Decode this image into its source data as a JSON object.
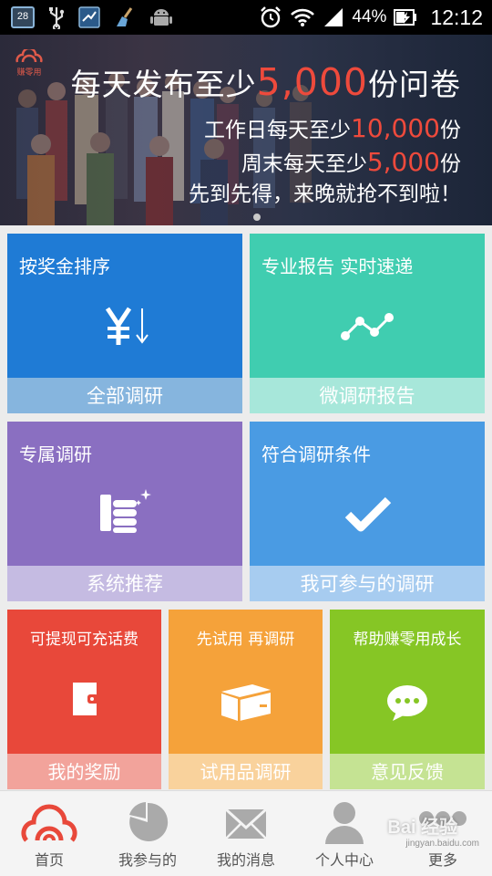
{
  "status_bar": {
    "calendar_day": "28",
    "battery_percent": "44%",
    "time": "12:12",
    "icons": [
      "calendar-icon",
      "usb-icon",
      "tool-icon",
      "broom-icon",
      "android-icon",
      "alarm-icon",
      "wifi-icon",
      "signal-icon",
      "battery-icon"
    ]
  },
  "banner": {
    "logo_text": "赚零用",
    "headline_prefix": "每天发布至少",
    "headline_number": "5,000",
    "headline_suffix": "份问卷",
    "line1_prefix": "工作日每天至少",
    "line1_number": "10,000",
    "line1_suffix": "份",
    "line2_prefix": "周末每天至少",
    "line2_number": "5,000",
    "line2_suffix": "份",
    "line3": "先到先得，来晚就抢不到啦！",
    "accent_color": "#ee4a3c"
  },
  "tiles": {
    "all": {
      "title": "按奖金排序",
      "label": "全部调研",
      "icon": "yen-sort-icon",
      "color": "#1f7bd5"
    },
    "micro": {
      "title": "专业报告 实时速递",
      "label": "微调研报告",
      "icon": "trend-line-icon",
      "color": "#40cdb0"
    },
    "system": {
      "title": "专属调研",
      "label": "系统推荐",
      "icon": "coins-hand-icon",
      "color": "#8a6fc1"
    },
    "eligible": {
      "title": "符合调研条件",
      "label": "我可参与的调研",
      "icon": "checkmark-icon",
      "color": "#4a9be3"
    },
    "reward": {
      "title": "可提现可充话费",
      "label": "我的奖励",
      "icon": "wallet-icon",
      "color": "#e8483a"
    },
    "trial": {
      "title": "先试用 再调研",
      "label": "试用品调研",
      "icon": "package-icon",
      "color": "#f5a23a"
    },
    "feedback": {
      "title": "帮助赚零用成长",
      "label": "意见反馈",
      "icon": "chat-bubble-icon",
      "color": "#86c625"
    }
  },
  "bottom_nav": {
    "items": [
      {
        "label": "首页",
        "icon": "home-logo-icon"
      },
      {
        "label": "我参与的",
        "icon": "pie-chart-icon"
      },
      {
        "label": "我的消息",
        "icon": "envelope-icon"
      },
      {
        "label": "个人中心",
        "icon": "person-icon"
      },
      {
        "label": "更多",
        "icon": "more-dots-icon"
      }
    ],
    "active_index": 0
  },
  "watermark": {
    "text": "Bai 经验",
    "sub": "jingyan.baidu.com"
  }
}
